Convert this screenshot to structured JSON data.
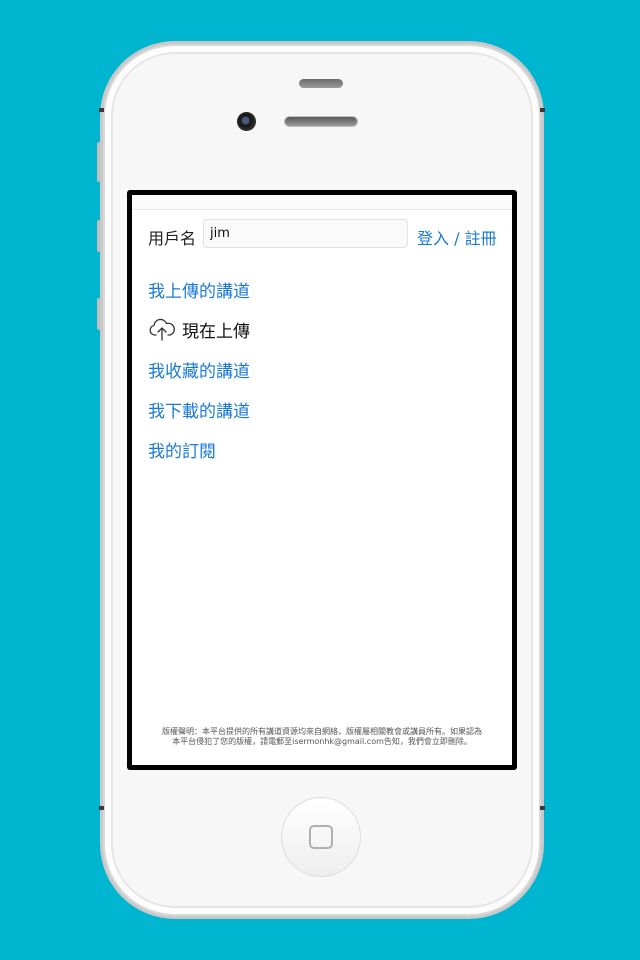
{
  "login": {
    "username_label": "用戶名",
    "username_value": "jim",
    "login_register": "登入 / 註冊"
  },
  "menu": {
    "items": [
      {
        "label": "我上傳的講道"
      },
      {
        "label": "現在上傳",
        "icon": "cloud-upload-icon"
      },
      {
        "label": "我收藏的講道"
      },
      {
        "label": "我下載的講道"
      },
      {
        "label": "我的訂閱"
      }
    ]
  },
  "footer": {
    "disclaimer_line1": "版權聲明：本平台提供的所有講道資源均來自網絡，版權屬相關教會或講員所有。如果認為",
    "disclaimer_line2": "本平台侵犯了您的版權，請電郵至isermonhk@gmail.com告知，我們會立即刪除。"
  },
  "colors": {
    "background": "#00b5cf",
    "link": "#1a7ad8"
  }
}
